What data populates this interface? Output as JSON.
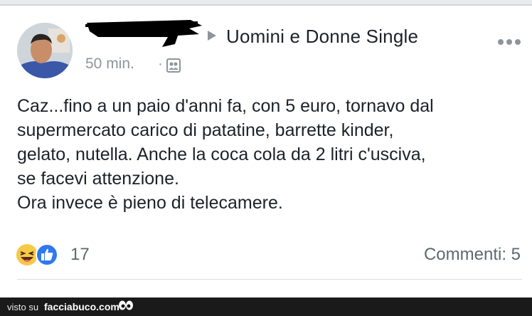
{
  "post": {
    "group_name": "Uomini e Donne Single",
    "timestamp": "50 min.",
    "separator": "·",
    "text_lines": [
      "Caz...fino a un paio d'anni fa, con 5 euro, tornavo dal",
      "supermercato carico di patatine, barrette kinder,",
      "gelato, nutella. Anche la coca cola da 2 litri c'usciva,",
      "se facevi attenzione.",
      "Ora invece è pieno di telecamere."
    ],
    "reaction_count": "17",
    "comments_label": "Commenti: 5",
    "icons": {
      "author_avatar": "avatar",
      "redacted_name": "redacted-name-scribble",
      "shared_to_arrow": "triangle-right-icon",
      "more_options": "more-dots-icon",
      "audience": "group-audience-icon",
      "reaction_haha": "haha-reaction-icon",
      "reaction_like": "like-reaction-icon"
    }
  },
  "watermark": {
    "prefix": "visto su",
    "site": "facciabuco.com"
  },
  "colors": {
    "text": "#1d2129",
    "meta": "#90949c",
    "like_blue": "#2f78f0",
    "haha_yellow": "#f7c945"
  }
}
